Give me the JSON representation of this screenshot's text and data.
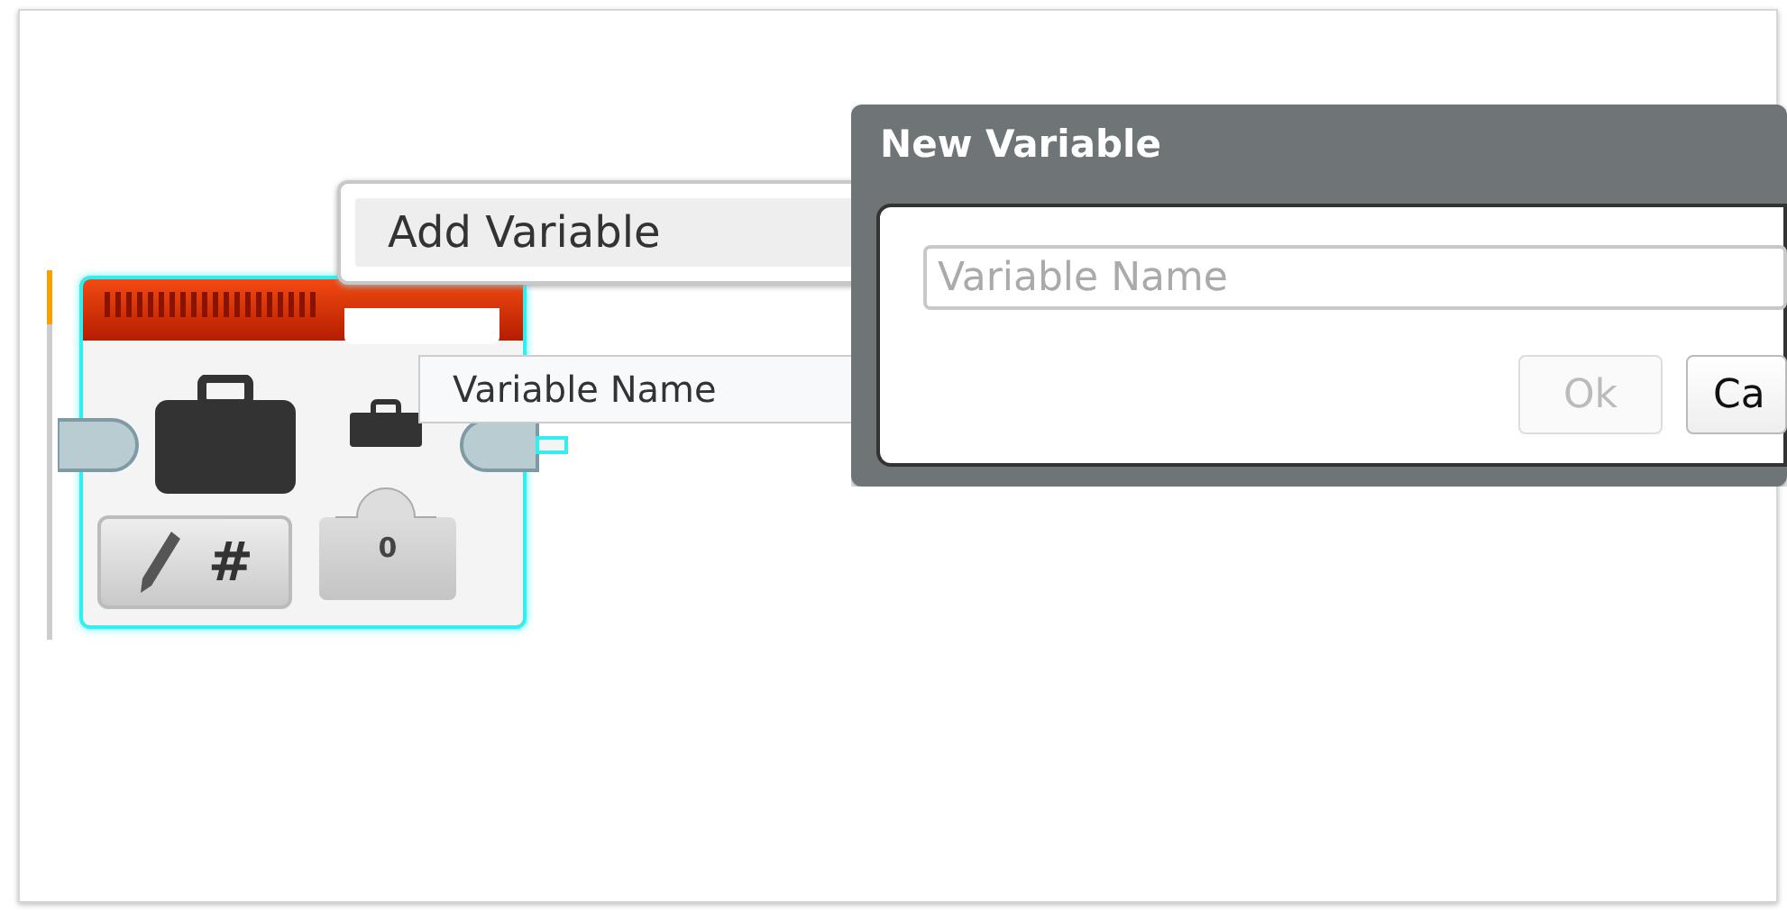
{
  "block": {
    "mode_label": "#",
    "value": "0"
  },
  "menu": {
    "items": [
      {
        "label": "Add Variable",
        "selected": true
      }
    ]
  },
  "tooltip": {
    "text": "Variable Name"
  },
  "dialog": {
    "title": "New Variable",
    "input": {
      "placeholder": "Variable Name"
    },
    "buttons": [
      {
        "label": "Ok",
        "disabled": true
      },
      {
        "label": "Ca",
        "disabled": false
      }
    ]
  }
}
